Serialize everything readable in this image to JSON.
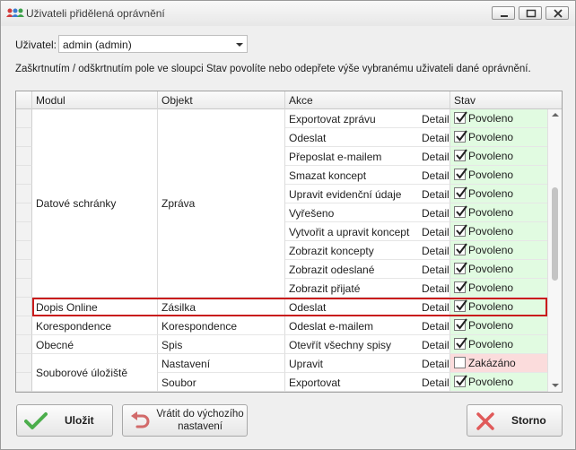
{
  "window": {
    "title": "Uživateli přidělená oprávnění"
  },
  "user": {
    "label": "Uživatel:",
    "value": "admin (admin)"
  },
  "hint": "Zaškrtnutím / odškrtnutím pole ve sloupci Stav povolíte nebo odepřete výše vybranému uživateli dané oprávnění.",
  "columns": {
    "modul": "Modul",
    "objekt": "Objekt",
    "akce": "Akce",
    "stav": "Stav"
  },
  "merged": {
    "datove_modul": "Datové schránky",
    "datove_objekt": "Zpráva",
    "soubor_modul": "Souborové úložiště"
  },
  "rows": [
    {
      "modul": "",
      "objekt": "",
      "akce": "Exportovat zprávu",
      "detail": "Detail",
      "stav": "Povoleno",
      "checked": true
    },
    {
      "modul": "",
      "objekt": "",
      "akce": "Odeslat",
      "detail": "Detail",
      "stav": "Povoleno",
      "checked": true
    },
    {
      "modul": "",
      "objekt": "",
      "akce": "Přeposlat e-mailem",
      "detail": "Detail",
      "stav": "Povoleno",
      "checked": true
    },
    {
      "modul": "",
      "objekt": "",
      "akce": "Smazat koncept",
      "detail": "Detail",
      "stav": "Povoleno",
      "checked": true
    },
    {
      "modul": "",
      "objekt": "",
      "akce": "Upravit evidenční údaje",
      "detail": "Detail",
      "stav": "Povoleno",
      "checked": true
    },
    {
      "modul": "",
      "objekt": "",
      "akce": "Vyřešeno",
      "detail": "Detail",
      "stav": "Povoleno",
      "checked": true
    },
    {
      "modul": "",
      "objekt": "",
      "akce": "Vytvořit a upravit koncept",
      "detail": "Detail",
      "stav": "Povoleno",
      "checked": true
    },
    {
      "modul": "",
      "objekt": "",
      "akce": "Zobrazit koncepty",
      "detail": "Detail",
      "stav": "Povoleno",
      "checked": true
    },
    {
      "modul": "",
      "objekt": "",
      "akce": "Zobrazit odeslané",
      "detail": "Detail",
      "stav": "Povoleno",
      "checked": true
    },
    {
      "modul": "",
      "objekt": "",
      "akce": "Zobrazit přijaté",
      "detail": "Detail",
      "stav": "Povoleno",
      "checked": true
    },
    {
      "modul": "Dopis Online",
      "objekt": "Zásilka",
      "akce": "Odeslat",
      "detail": "Detail",
      "stav": "Povoleno",
      "checked": true
    },
    {
      "modul": "Korespondence",
      "objekt": "Korespondence",
      "akce": "Odeslat e-mailem",
      "detail": "Detail",
      "stav": "Povoleno",
      "checked": true
    },
    {
      "modul": "Obecné",
      "objekt": "Spis",
      "akce": "Otevřít všechny spisy",
      "detail": "Detail",
      "stav": "Povoleno",
      "checked": true
    },
    {
      "modul": "",
      "objekt": "Nastavení",
      "akce": "Upravit",
      "detail": "Detail",
      "stav": "Zakázáno",
      "checked": false
    },
    {
      "modul": "",
      "objekt": "Soubor",
      "akce": "Exportovat",
      "detail": "Detail",
      "stav": "Povoleno",
      "checked": true
    }
  ],
  "buttons": {
    "save": "Uložit",
    "reset_line1": "Vrátit do výchozího",
    "reset_line2": "nastavení",
    "cancel": "Storno"
  },
  "colors": {
    "allowed_bg": "#e1fbe1",
    "denied_bg": "#fbdcdc",
    "selection_border": "#c91c1c"
  }
}
